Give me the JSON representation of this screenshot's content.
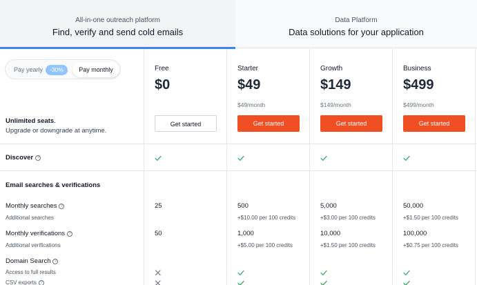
{
  "tabs": [
    {
      "sub": "All-in-one outreach platform",
      "main": "Find, verify and send cold emails"
    },
    {
      "sub": "Data Platform",
      "main": "Data solutions for your application"
    }
  ],
  "billing": {
    "yearly_label": "Pay yearly",
    "discount_badge": "-30%",
    "monthly_label": "Pay monthly"
  },
  "seats": {
    "title": "Unlimited seats",
    "subtitle": "Upgrade or downgrade at anytime."
  },
  "plans": [
    {
      "name": "Free",
      "price": "$0",
      "per_month": "",
      "cta": "Get started"
    },
    {
      "name": "Starter",
      "price": "$49",
      "per_month": "$49/month",
      "cta": "Get started"
    },
    {
      "name": "Growth",
      "price": "$149",
      "per_month": "$149/month",
      "cta": "Get started"
    },
    {
      "name": "Business",
      "price": "$499",
      "per_month": "$499/month",
      "cta": "Get started"
    }
  ],
  "features": {
    "discover": {
      "label": "Discover",
      "values": [
        "check",
        "check",
        "check",
        "check"
      ]
    },
    "email_section": {
      "label": "Email searches & verifications"
    },
    "monthly_searches": {
      "label": "Monthly searches",
      "values": [
        "25",
        "500",
        "5,000",
        "50,000"
      ],
      "sub_label": "Additional searches",
      "sub_values": [
        "",
        "+$10.00 per 100 credits",
        "+$3.00 per 100 credits",
        "+$1.50 per 100 credits"
      ]
    },
    "monthly_verifications": {
      "label": "Monthly verifications",
      "values": [
        "50",
        "1,000",
        "10,000",
        "100,000"
      ],
      "sub_label": "Additional verifications",
      "sub_values": [
        "",
        "+$5.00 per 100 credits",
        "+$1.50 per 100 credits",
        "+$0.75 per 100 credits"
      ]
    },
    "domain_search": {
      "label": "Domain Search"
    },
    "full_results": {
      "label": "Access to full results",
      "values": [
        "cross",
        "check",
        "check",
        "check"
      ]
    },
    "csv_exports": {
      "label": "CSV exports",
      "values": [
        "cross",
        "check",
        "check",
        "check"
      ]
    }
  },
  "colors": {
    "accent": "#3b82f6",
    "cta": "#f04e23",
    "check": "#22a559",
    "cross": "#6b7280",
    "badge": "#93c5fd"
  }
}
